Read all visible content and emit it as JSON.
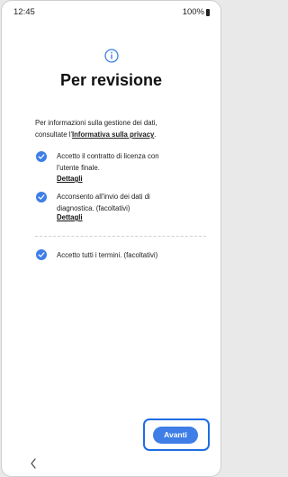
{
  "status_bar": {
    "time": "12:45",
    "battery": "100%"
  },
  "header": {
    "title": "Per revisione"
  },
  "intro": {
    "text_line1": "Per informazioni sulla gestione dei dati,",
    "text_line2_prefix": "consultate l'",
    "privacy_link": "Informativa sulla privacy",
    "text_line2_suffix": "."
  },
  "items": [
    {
      "line1": "Accetto il contratto di licenza con",
      "line2": "l'utente finale.",
      "details": "Dettagli",
      "checked": true
    },
    {
      "line1": "Acconsento all'invio dei dati di",
      "line2": "diagnostica. (facoltativi)",
      "details": "Dettagli",
      "checked": true
    }
  ],
  "accept_all": {
    "label": "Accetto tutti i termini. (facoltativi)",
    "checked": true
  },
  "footer": {
    "next_label": "Avanti"
  },
  "colors": {
    "accent": "#3e7ee6",
    "highlight": "#1e6de2"
  }
}
